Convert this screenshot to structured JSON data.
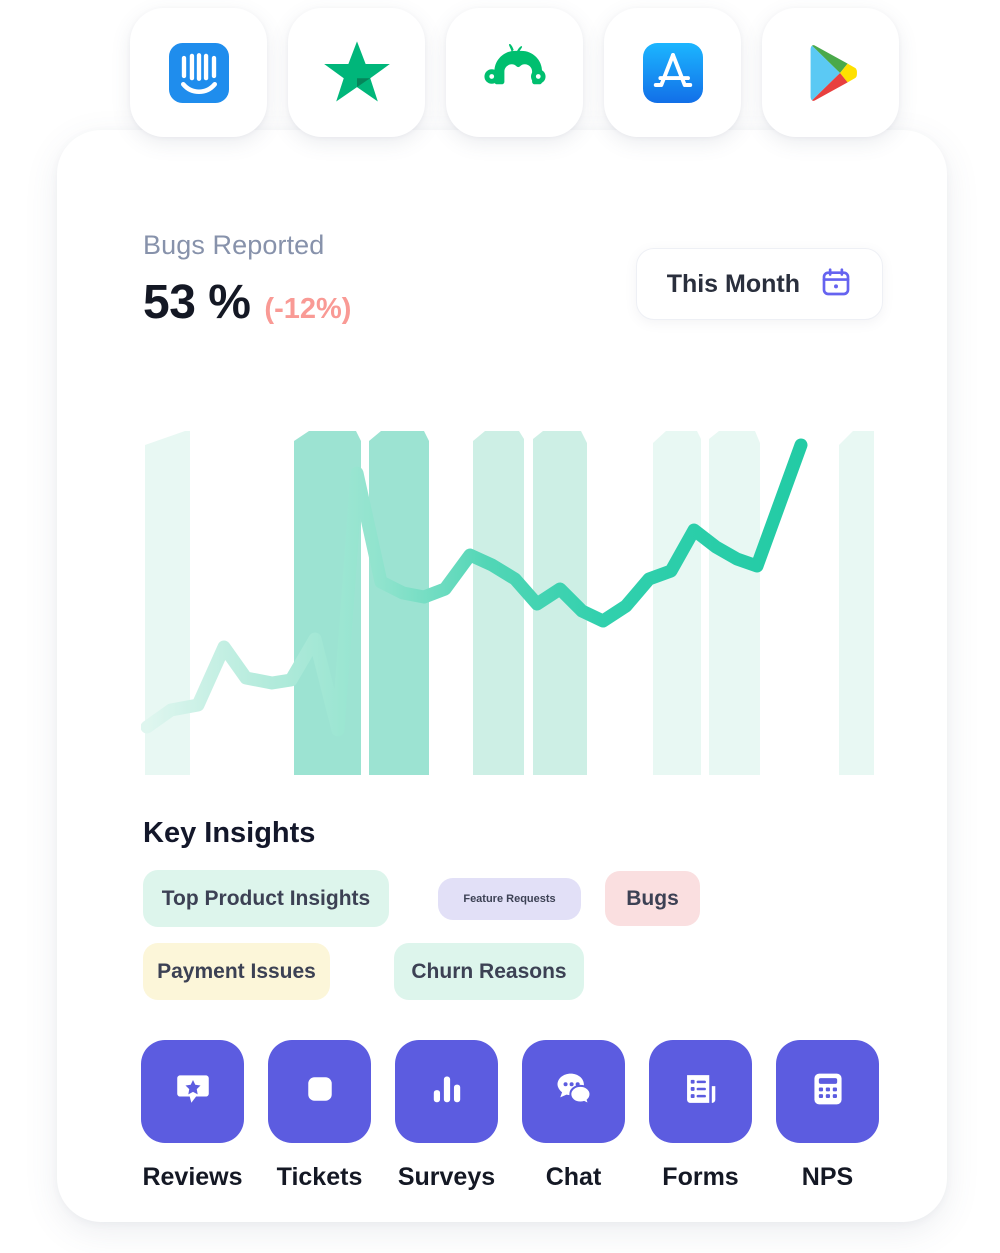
{
  "sources": [
    {
      "name": "intercom",
      "label": "Intercom"
    },
    {
      "name": "trustpilot",
      "label": "Trustpilot"
    },
    {
      "name": "surveymonkey",
      "label": "SurveyMonkey"
    },
    {
      "name": "app-store",
      "label": "App Store"
    },
    {
      "name": "google-play",
      "label": "Google Play"
    }
  ],
  "metric": {
    "label": "Bugs Reported",
    "value": "53 %",
    "delta": "(-12%)",
    "delta_color": "#f99a95"
  },
  "range": {
    "label": "This Month",
    "icon": "calendar-icon",
    "icon_color": "#6563f0"
  },
  "insights": {
    "title": "Key Insights",
    "tags": [
      {
        "label": "Top Product Insights",
        "color": "#ddf5ec",
        "cls": "t-top"
      },
      {
        "label": "Feature Requests",
        "color": "#e2e0f7",
        "cls": "t-feature"
      },
      {
        "label": "Bugs",
        "color": "#fadfe0",
        "cls": "t-bugs"
      },
      {
        "label": "Payment Issues",
        "color": "#fcf6d9",
        "cls": "t-payment"
      },
      {
        "label": "Churn Reasons",
        "color": "#ddf5ec",
        "cls": "t-churn"
      }
    ]
  },
  "nav": [
    {
      "label": "Reviews",
      "icon": "review-star-bubble-icon"
    },
    {
      "label": "Tickets",
      "icon": "ticket-square-icon"
    },
    {
      "label": "Surveys",
      "icon": "bar-chart-icon"
    },
    {
      "label": "Chat",
      "icon": "chat-bubbles-icon"
    },
    {
      "label": "Forms",
      "icon": "form-document-icon"
    },
    {
      "label": "NPS",
      "icon": "calculator-icon"
    }
  ],
  "chart_data": {
    "type": "line",
    "title": "Bugs Reported",
    "xlabel": "",
    "ylabel": "",
    "grid": false,
    "legend": null,
    "line_color": "#2ed0ab",
    "line_gradient": [
      "#d8f5ec",
      "#25cda6"
    ],
    "band_color_light": "#e8f8f3",
    "band_color_strong": "#9ce3d2",
    "ylim": [
      0,
      100
    ],
    "x": [
      0,
      1,
      2,
      3,
      4,
      5,
      6,
      7,
      8,
      9,
      10,
      11,
      12,
      13,
      14,
      15,
      16,
      17,
      18,
      19,
      20,
      21,
      22,
      23,
      24,
      25,
      26,
      27,
      28
    ],
    "values": [
      14,
      22,
      25,
      46,
      32,
      29,
      30,
      44,
      19,
      92,
      58,
      54,
      53,
      56,
      66,
      62,
      58,
      50,
      54,
      48,
      45,
      49,
      58,
      60,
      72,
      66,
      62,
      60,
      94
    ],
    "bands": [
      {
        "from": 0.15,
        "to": 1.85,
        "intensity": "light"
      },
      {
        "from": 5.9,
        "to": 7.6,
        "intensity": "strong"
      },
      {
        "from": 7.75,
        "to": 9.4,
        "intensity": "strong"
      },
      {
        "from": 12.6,
        "to": 14.1,
        "intensity": "light"
      },
      {
        "from": 14.3,
        "to": 16.3,
        "intensity": "light"
      },
      {
        "from": 19.6,
        "to": 21.1,
        "intensity": "light"
      },
      {
        "from": 21.3,
        "to": 23.1,
        "intensity": "light"
      },
      {
        "from": 27.0,
        "to": 28.6,
        "intensity": "light"
      }
    ]
  }
}
